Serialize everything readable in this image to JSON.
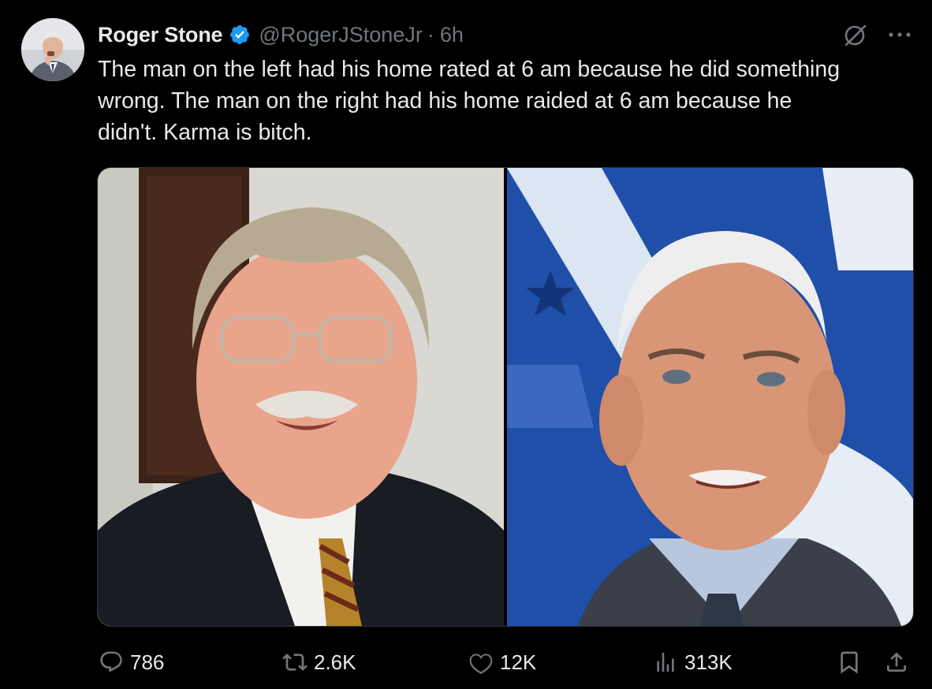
{
  "author": {
    "name": "Roger Stone",
    "handle": "@RogerJStoneJr",
    "separator": "·",
    "time": "6h"
  },
  "post": {
    "lines": [
      "The man on the left had his home rated at 6 am because he did something",
      "wrong. The man on the right had his home raided at 6 am because he",
      "didn't. Karma is bitch."
    ]
  },
  "media": {
    "left_photo": "older-man-glasses-mustache-portrait",
    "right_photo": "man-speaking-blue-backdrop"
  },
  "actions": {
    "replies": "786",
    "reposts": "2.6K",
    "likes": "12K",
    "views": "313K"
  },
  "colors": {
    "background": "#000000",
    "text_primary": "#e7e9ea",
    "text_secondary": "#71767b",
    "verified_blue": "#1d9bf0",
    "border": "#2f3336"
  },
  "icons": [
    "verified-badge-icon",
    "grok-icon",
    "more-icon",
    "reply-icon",
    "repost-icon",
    "like-icon",
    "views-icon",
    "bookmark-icon",
    "share-icon"
  ]
}
